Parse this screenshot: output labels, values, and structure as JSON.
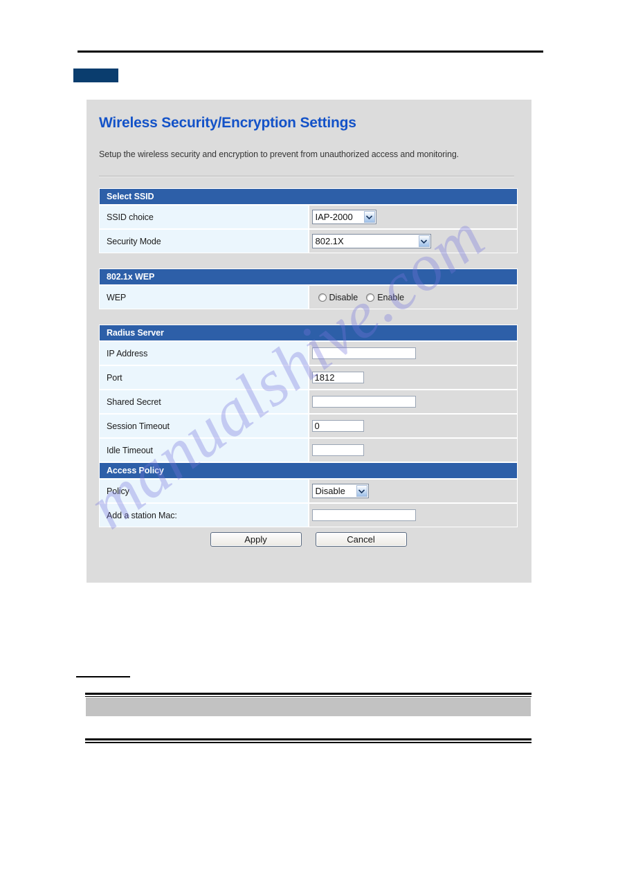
{
  "page": {
    "watermark": "manualshive.com"
  },
  "panel": {
    "title": "Wireless Security/Encryption Settings",
    "subtitle": "Setup the wireless security and encryption to prevent from unauthorized access and monitoring.",
    "accent_color": "#2d5fa8",
    "title_color": "#1352c8",
    "background_color": "#dcdcdc",
    "label_cell_color": "#ebf6fd"
  },
  "sections": {
    "select_ssid": {
      "header": "Select SSID",
      "rows": [
        {
          "label": "SSID choice",
          "control": "select",
          "value": "IAP-2000"
        },
        {
          "label": "Security Mode",
          "control": "select",
          "value": "802.1X"
        }
      ]
    },
    "wep": {
      "header": "802.1x WEP",
      "rows": [
        {
          "label": "WEP",
          "control": "radio",
          "options": [
            {
              "label": "Disable",
              "selected": false
            },
            {
              "label": "Enable",
              "selected": false
            }
          ]
        }
      ]
    },
    "radius_server": {
      "header": "Radius Server",
      "rows": [
        {
          "label": "IP Address",
          "control": "text",
          "value": ""
        },
        {
          "label": "Port",
          "control": "text",
          "value": "1812"
        },
        {
          "label": "Shared Secret",
          "control": "text",
          "value": ""
        },
        {
          "label": "Session Timeout",
          "control": "text",
          "value": "0"
        },
        {
          "label": "Idle Timeout",
          "control": "text",
          "value": ""
        }
      ]
    },
    "access_policy": {
      "header": "Access Policy",
      "rows": [
        {
          "label": "Policy",
          "control": "select",
          "value": "Disable"
        },
        {
          "label": "Add a station Mac:",
          "control": "text",
          "value": ""
        }
      ]
    }
  },
  "buttons": {
    "apply": "Apply",
    "cancel": "Cancel"
  }
}
